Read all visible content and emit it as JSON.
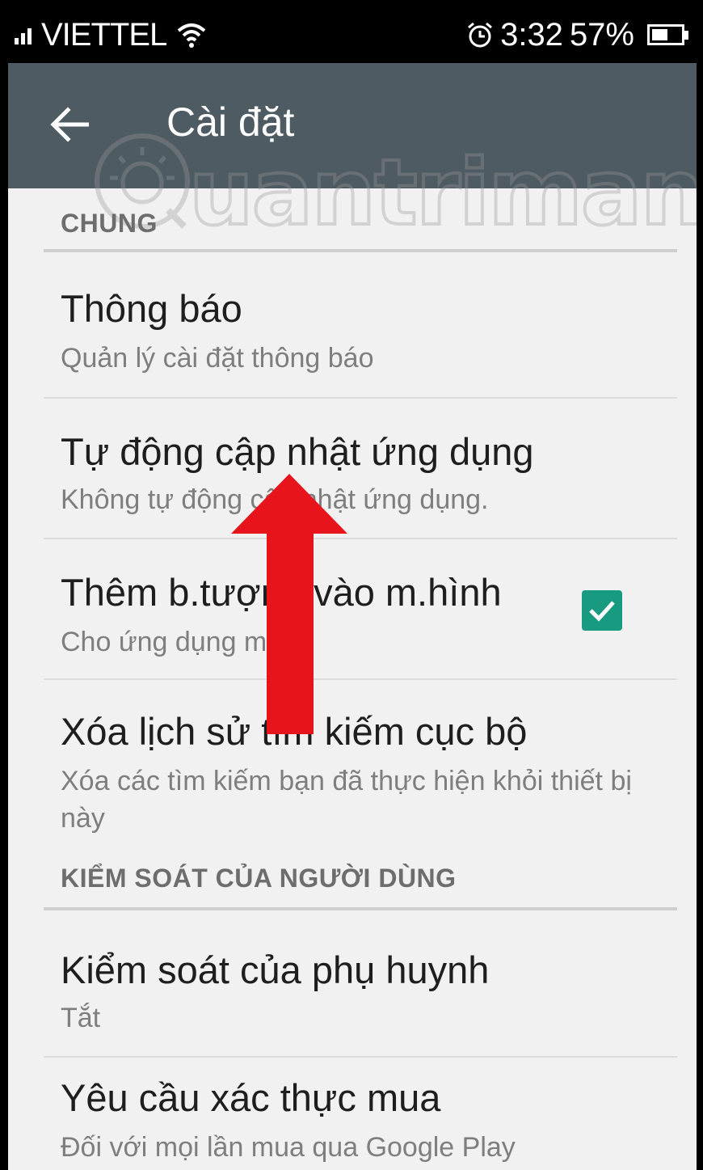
{
  "status_bar": {
    "carrier": "VIETTEL",
    "time": "3:32",
    "battery_percent": "57%"
  },
  "toolbar": {
    "title": "Cài đặt"
  },
  "watermark": {
    "text": "uantrimang"
  },
  "sections": {
    "general": {
      "header": "CHUNG",
      "items": [
        {
          "title": "Thông báo",
          "subtitle": "Quản lý cài đặt thông báo"
        },
        {
          "title": "Tự động cập nhật ứng dụng",
          "subtitle": "Không tự động cập nhật ứng dụng."
        },
        {
          "title": "Thêm b.tượng vào m.hình",
          "subtitle": "Cho ứng dụng mới",
          "checked": true
        },
        {
          "title": "Xóa lịch sử tìm kiếm cục bộ",
          "subtitle": "Xóa các tìm kiếm bạn đã thực hiện khỏi thiết bị này"
        }
      ]
    },
    "user_controls": {
      "header": "KIỂM SOÁT CỦA NGƯỜI DÙNG",
      "items": [
        {
          "title": "Kiểm soát của phụ huynh",
          "subtitle": "Tắt"
        },
        {
          "title": "Yêu cầu xác thực mua",
          "subtitle": "Đối với mọi lần mua qua Google Play"
        }
      ]
    }
  },
  "colors": {
    "toolbar": "#4f5b62",
    "checkbox": "#179a80",
    "annotation_arrow": "#e8141c"
  }
}
